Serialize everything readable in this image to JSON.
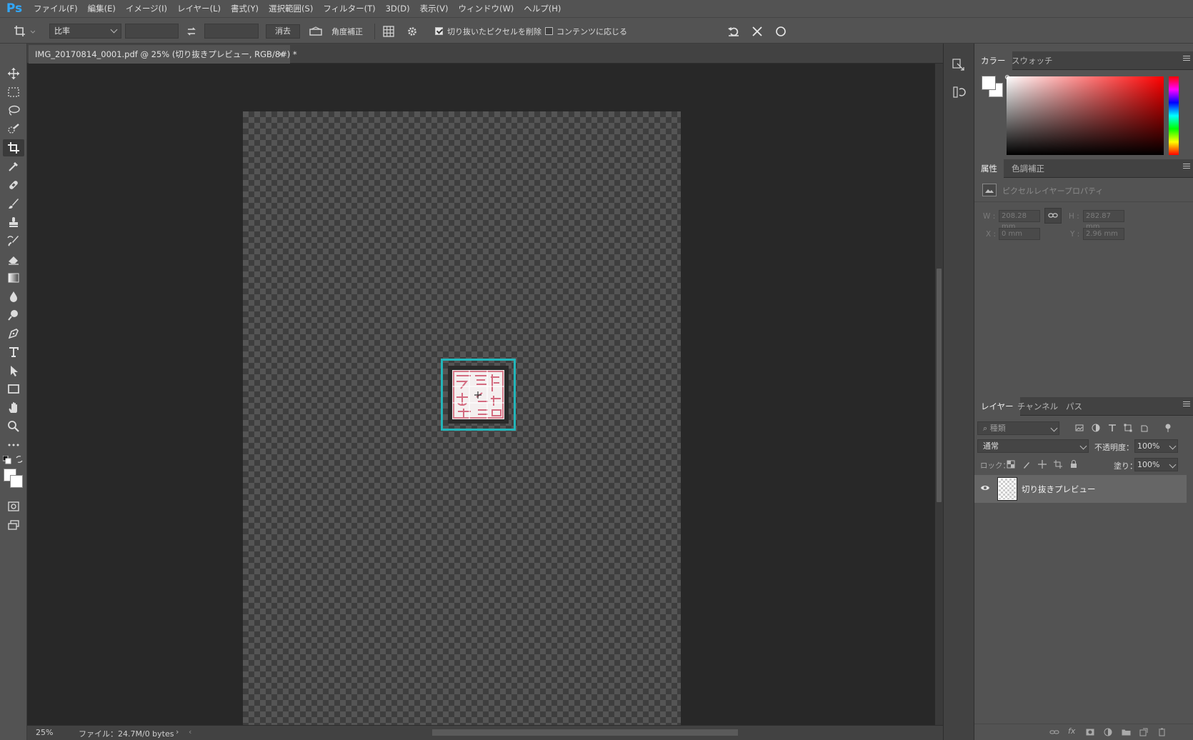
{
  "app": {
    "logo": "Ps"
  },
  "menu": [
    "ファイル(F)",
    "編集(E)",
    "イメージ(I)",
    "レイヤー(L)",
    "書式(Y)",
    "選択範囲(S)",
    "フィルター(T)",
    "3D(D)",
    "表示(V)",
    "ウィンドウ(W)",
    "ヘルプ(H)"
  ],
  "options": {
    "ratio_value": "比率",
    "width_value": "",
    "height_value": "",
    "clear_label": "消去",
    "straighten_label": "角度補正",
    "delete_cropped_label": "切り抜いたピクセルを削除",
    "delete_cropped_checked": true,
    "content_aware_label": "コンテンツに応じる",
    "content_aware_checked": false
  },
  "document": {
    "tab_title": "IMG_20170814_0001.pdf @ 25% (切り抜きプレビュー, RGB/8#) *",
    "close_glyph": "×",
    "zoom": "25%",
    "file_info": "ファイル：24.7M/0 bytes",
    "crop_frame_color": "#22b5b9",
    "canvas_bg": "#282828"
  },
  "color_panel": {
    "tabs": [
      "カラー",
      "スウォッチ"
    ],
    "active_tab": 0
  },
  "properties_panel": {
    "tabs": [
      "属性",
      "色調補正"
    ],
    "active_tab": 0,
    "subtitle": "ピクセルレイヤープロパティ",
    "w_label": "W :",
    "w_value": "208.28 mm",
    "h_label": "H :",
    "h_value": "282.87 mm",
    "x_label": "X :",
    "x_value": "0 mm",
    "y_label": "Y :",
    "y_value": "2.96 mm"
  },
  "layers_panel": {
    "tabs": [
      "レイヤー",
      "チャンネル",
      "パス"
    ],
    "active_tab": 0,
    "filter_placeholder": "種類",
    "blend_mode": "通常",
    "opacity_label": "不透明度：",
    "opacity_value": "100%",
    "lock_label": "ロック：",
    "fill_label": "塗り：",
    "fill_value": "100%",
    "layers": [
      {
        "name": "切り抜きプレビュー",
        "visible": true
      }
    ]
  }
}
